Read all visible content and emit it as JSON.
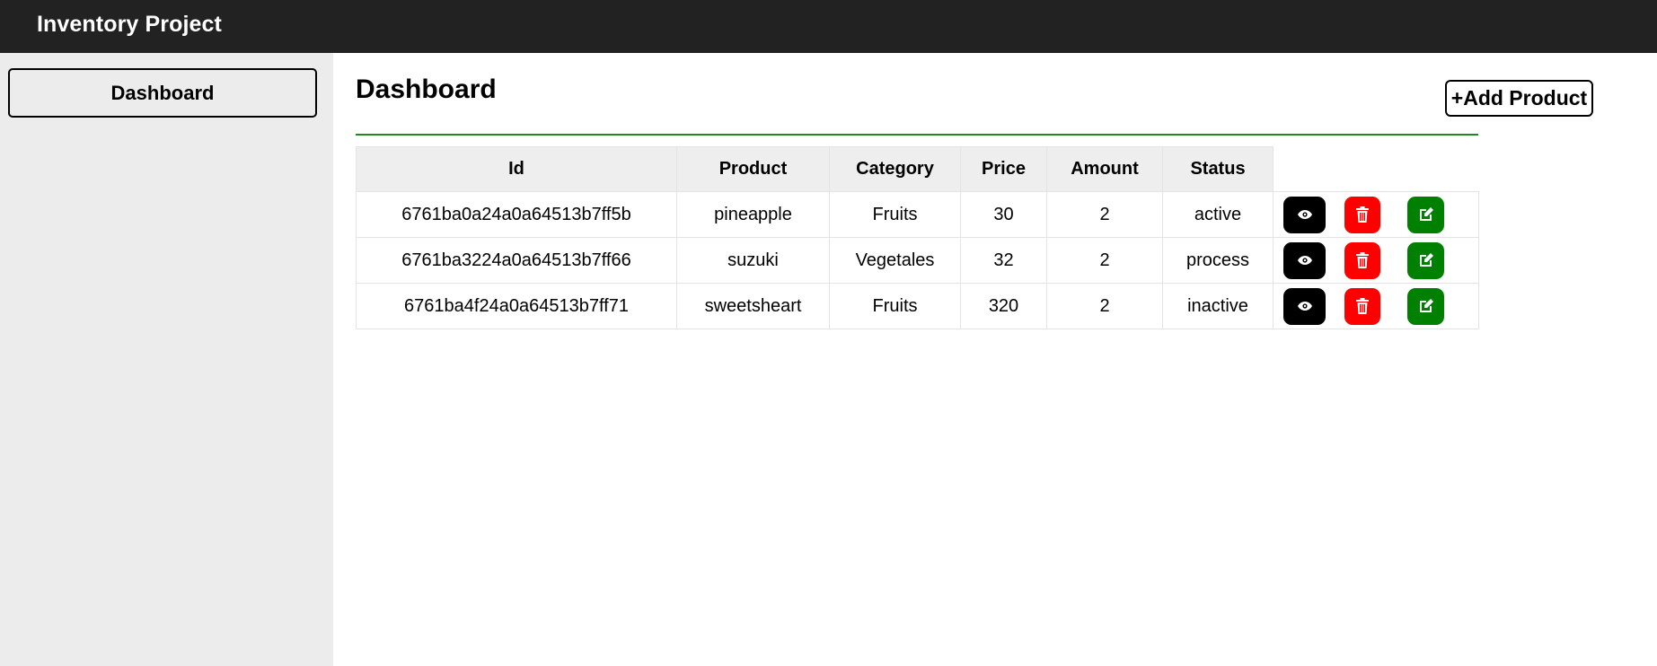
{
  "app": {
    "title": "Inventory Project"
  },
  "sidebar": {
    "items": [
      {
        "label": "Dashboard"
      }
    ]
  },
  "main": {
    "title": "Dashboard",
    "add_button_label": "+Add Product",
    "table": {
      "columns": [
        "Id",
        "Product",
        "Category",
        "Price",
        "Amount",
        "Status"
      ],
      "rows": [
        {
          "id": "6761ba0a24a0a64513b7ff5b",
          "product": "pineapple",
          "category": "Fruits",
          "price": "30",
          "amount": "2",
          "status": "active"
        },
        {
          "id": "6761ba3224a0a64513b7ff66",
          "product": "suzuki",
          "category": "Vegetales",
          "price": "32",
          "amount": "2",
          "status": "process"
        },
        {
          "id": "6761ba4f24a0a64513b7ff71",
          "product": "sweetsheart",
          "category": "Fruits",
          "price": "320",
          "amount": "2",
          "status": "inactive"
        }
      ],
      "row_actions": [
        {
          "icon": "eye-icon",
          "color": "#000000"
        },
        {
          "icon": "trash-icon",
          "color": "#ff0000"
        },
        {
          "icon": "edit-icon",
          "color": "#008000"
        }
      ]
    },
    "accent_rule_color": "#1e8a1e"
  }
}
